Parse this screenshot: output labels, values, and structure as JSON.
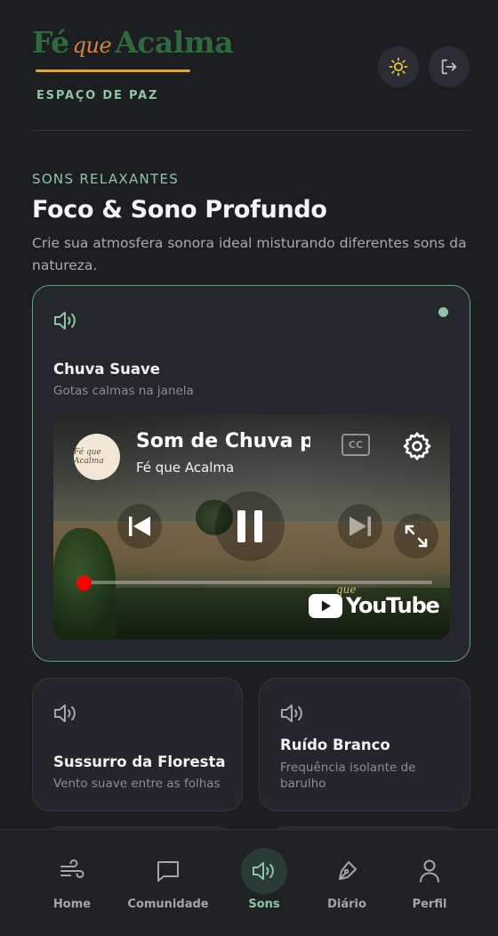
{
  "header": {
    "logo_part1": "Fé",
    "logo_part2": "que",
    "logo_part3": "Acalma",
    "tagline": "ESPAÇO DE PAZ",
    "theme_icon": "sun-icon",
    "logout_icon": "logout-icon"
  },
  "section": {
    "label": "SONS RELAXANTES",
    "title": "Foco & Sono Profundo",
    "description": "Crie sua atmosfera sonora ideal misturando diferentes sons da natureza."
  },
  "sounds": [
    {
      "title": "Chuva Suave",
      "subtitle": "Gotas calmas na janela",
      "active": true,
      "player": {
        "video_title": "Som de Chuva pa",
        "channel": "Fé que Acalma",
        "avatar_text": "Fé que Acalma",
        "cc_label": "CC",
        "brand": "YouTube",
        "watermark": "que",
        "progress": 0.02,
        "state": "playing"
      }
    },
    {
      "title": "Sussurro da Floresta",
      "subtitle": "Vento suave entre as folhas",
      "active": false
    },
    {
      "title": "Ruído Branco",
      "subtitle": "Frequência isolante de barulho",
      "active": false
    }
  ],
  "nav": [
    {
      "label": "Home",
      "icon": "wind-icon",
      "active": false
    },
    {
      "label": "Comunidade",
      "icon": "chat-icon",
      "active": false
    },
    {
      "label": "Sons",
      "icon": "speaker-icon",
      "active": true
    },
    {
      "label": "Diário",
      "icon": "pen-icon",
      "active": false
    },
    {
      "label": "Perfil",
      "icon": "user-icon",
      "active": false
    }
  ],
  "colors": {
    "accent": "#8ec5a6",
    "logo_green": "#2f6a3c",
    "logo_orange": "#d4843a",
    "background": "#1c1e21",
    "progress_red": "#ff0000"
  }
}
